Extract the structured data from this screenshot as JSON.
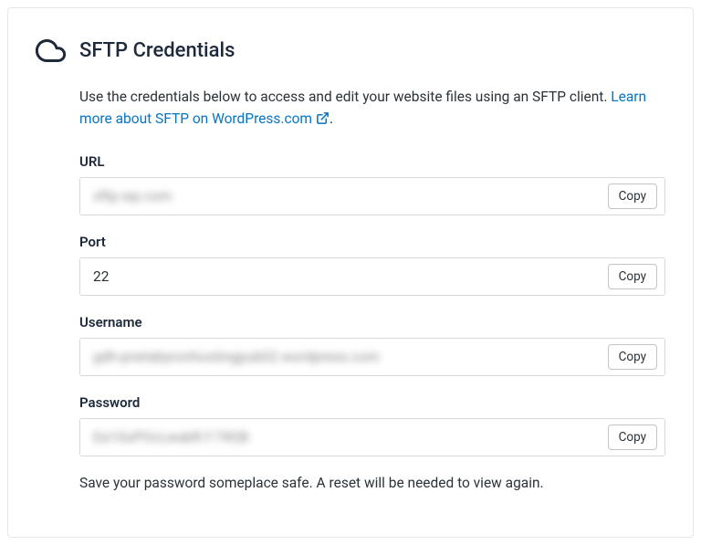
{
  "header": {
    "title": "SFTP Credentials"
  },
  "description": {
    "text": "Use the credentials below to access and edit your website files using an SFTP client. ",
    "link_text": "Learn more about SFTP on WordPress.com",
    "period": "."
  },
  "fields": {
    "url": {
      "label": "URL",
      "value": "sftp.wp.com",
      "blurred": true,
      "copy_label": "Copy"
    },
    "port": {
      "label": "Port",
      "value": "22",
      "blurred": false,
      "copy_label": "Copy"
    },
    "username": {
      "label": "Username",
      "value": "gdh-pnetabyronhostingpub02.wordpress.com",
      "blurred": true,
      "copy_label": "Copy"
    },
    "password": {
      "label": "Password",
      "value": "Ea1GsPOcLwabR.f-7W)B",
      "blurred": true,
      "copy_label": "Copy"
    }
  },
  "footer": {
    "note": "Save your password someplace safe. A reset will be needed to view again."
  }
}
